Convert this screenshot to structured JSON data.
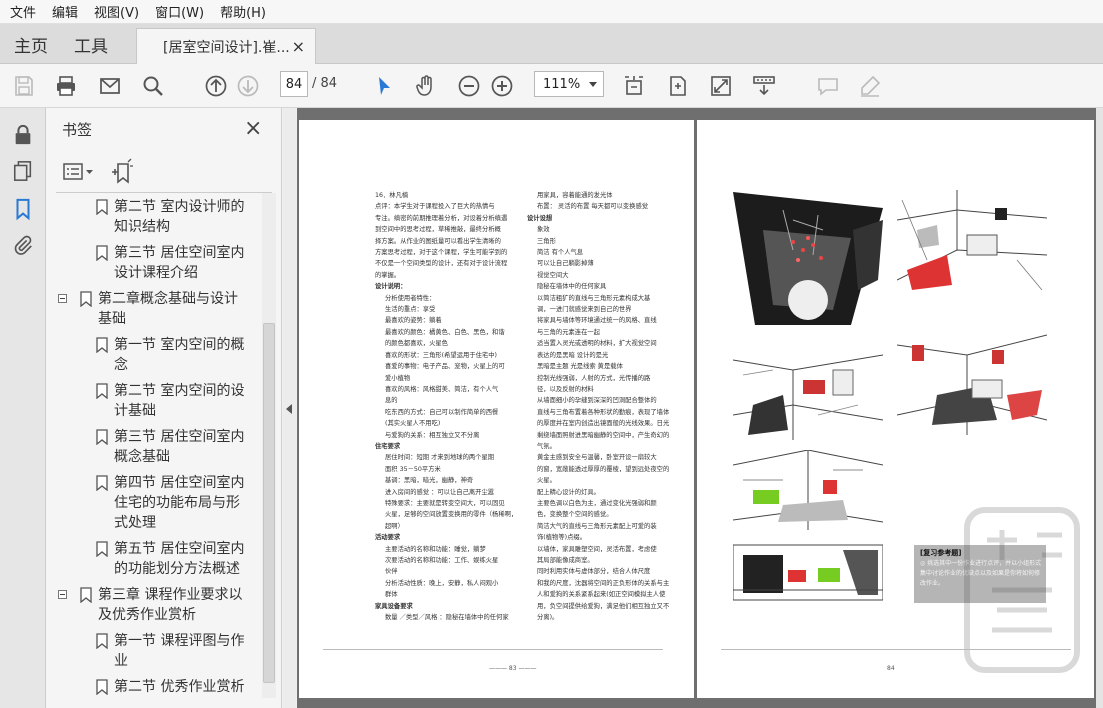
{
  "menu": [
    "文件",
    "编辑",
    "视图(V)",
    "窗口(W)",
    "帮助(H)"
  ],
  "tabs": {
    "home": "主页",
    "tools": "工具",
    "document": "[居室空间设计].崔...",
    "close": "×"
  },
  "toolbar": {
    "current_page": "84",
    "total_pages": "/ 84",
    "zoom": "111%"
  },
  "bookmarks_panel": {
    "title": "书签",
    "close": "×",
    "items": [
      {
        "lines": [
          "第二节  室内设计师的",
          "知识结构"
        ],
        "level": 2
      },
      {
        "lines": [
          "第三节  居住空间室内",
          "设计课程介绍"
        ],
        "level": 2
      },
      {
        "lines": [
          "第二章概念基础与设计",
          "基础"
        ],
        "level": 1
      },
      {
        "lines": [
          "第一节  室内空间的概",
          "念"
        ],
        "level": 2
      },
      {
        "lines": [
          "第二节  室内空间的设",
          "计基础"
        ],
        "level": 2
      },
      {
        "lines": [
          "第三节  居住空间室内",
          "概念基础"
        ],
        "level": 2
      },
      {
        "lines": [
          "第四节  居住空间室内",
          "住宅的功能布局与形",
          "式处理"
        ],
        "level": 2
      },
      {
        "lines": [
          "第五节  居住空间室内",
          "的功能划分方法概述"
        ],
        "level": 2
      },
      {
        "lines": [
          "第三章  课程作业要求以",
          "及优秀作业赏析"
        ],
        "level": 1
      },
      {
        "lines": [
          "第一节  课程评图与作",
          "业"
        ],
        "level": 2
      },
      {
        "lines": [
          "第二节  优秀作业赏析"
        ],
        "level": 2
      }
    ]
  },
  "page_left": {
    "col1": [
      "16．林凡楠",
      "点评：本学生对于课程投入了巨大的热情与",
      "专注。缜密的前期推理着分析，对设着分析缜遇",
      "到空间中的思考过程，草稀推敲，最终分析概",
      "择方案。从作业的图纸量可以看出学生清晰的",
      "方案思考过程，对于这个课程，学生可能学到的",
      "不仅是一个空间类型的设计，还有对于设计流程",
      "的掌握。",
      "设计说明：",
      "分析使用者特性：",
      "生活的重点：享受",
      "最喜欢的姿势：躺着",
      "最喜欢的颜色：橘黄色、白色、黑色，和谐",
      "的颜色都喜欢，火星色",
      "喜欢的形状：三角形(希望运用于住宅中)",
      "喜爱的事物：电子产品、宠物，火星上的可",
      "爱小植物",
      "喜欢的风格：风格甜美、简洁，有个人气",
      "息的",
      "吃东西的方式：自己可以制作简单的西餐",
      "(其实火星人不用吃)",
      "与爱狗的关系：相互独立又不分离",
      "住宅要求",
      "居住时间：短期   才来到地球的两个星期",
      "面积  35－50平方米",
      "基调：黑暗，暗光，幽静，神奇",
      "进入房间的感觉 ：可以让自己离开尘嚣",
      "特殊要求：主要就是转变空间大，可以固见",
      "火星，足够的空间放置变换用的零件（杨稀啊，",
      "超啊）",
      "活动要求",
      "主要活动的名称和功能：睡觉，躺梦",
      "次要活动的名称和功能：工作、娱练火星",
      "伙伴",
      "分析活动性质：晚上，安静，私人闷观小",
      "群体",
      "家具设备要求",
      "数量 ／类型／风格 ：隐秘在墙体中的任何家"
    ],
    "col2": [
      "用家具，容着能通的发光体",
      "布置：  灵活的布置 每天都可以变换感觉",
      "设计设想",
      "象效",
      "三角形",
      "简洁  有个人气息",
      "可以让自己躺影掉薄",
      "视觉空间大",
      "隐秘在墙体中的任何家具",
      "以简洁粗犷的直线与三角形元素构成大基",
      "调，一进门就感觉来到自己的世界",
      "将家具与墙体等环境通过统一的风格、直线",
      "与三角的元素连在一起",
      "适当置入灵光或透明的材料，扩大视觉空间",
      "表达的是黑暗  设计的是光",
      "黑暗是主题  光是线索   黄是载体",
      "控制光线强弱，人射的方式，光传播的路",
      "径，以及反射的材料",
      "从墙面细小的孕缝到深深的凹洞配合整体的",
      "直线与三角布置着各种形状的勤痕，表现了墙体",
      "的厚度并在室内创造出镜面般的光线效果。日光",
      "剩绕墙面照射进黑暗幽静的空间中，产生奇幻的",
      "气氛。",
      "黄金主感到安全与温馨，卧室开设一扇较大",
      "的窗，宽敞能透过厚厚的覆棱，望到远处夜空的",
      "火星。",
      "配上精心设计的灯具。",
      "主要色调以白色为主，通过变化光强弱和颜",
      "色，变换整个空间的感觉。",
      "简洁大气的直线与三角形元素配上可爱的装",
      "饰(植物等)点缀。",
      "以墙体，家具雕塑空间，灵活布置，考虑使",
      "其局部能像成商室。",
      "同时利用实体与虚体部分，结合人体尺度",
      "和我的尺度，沈器将空间的正负形体的关系与主",
      "人和爱狗的关系紧系起来(如正空间模拟主人使",
      "用，负空间提供给爱狗，满足他们相互独立又不",
      "分离)。"
    ],
    "page_number": "83"
  },
  "page_right": {
    "review_title": "[复习参考题]",
    "review_text": "◎  挑选其中一份作业进行点评，并以小组形式集中讨论作业的优缺点以及如果是你将如何修改作业。",
    "page_number": "84"
  },
  "colors": {
    "accent": "#2a7ad5",
    "doc_background": "#6f6f6f"
  }
}
